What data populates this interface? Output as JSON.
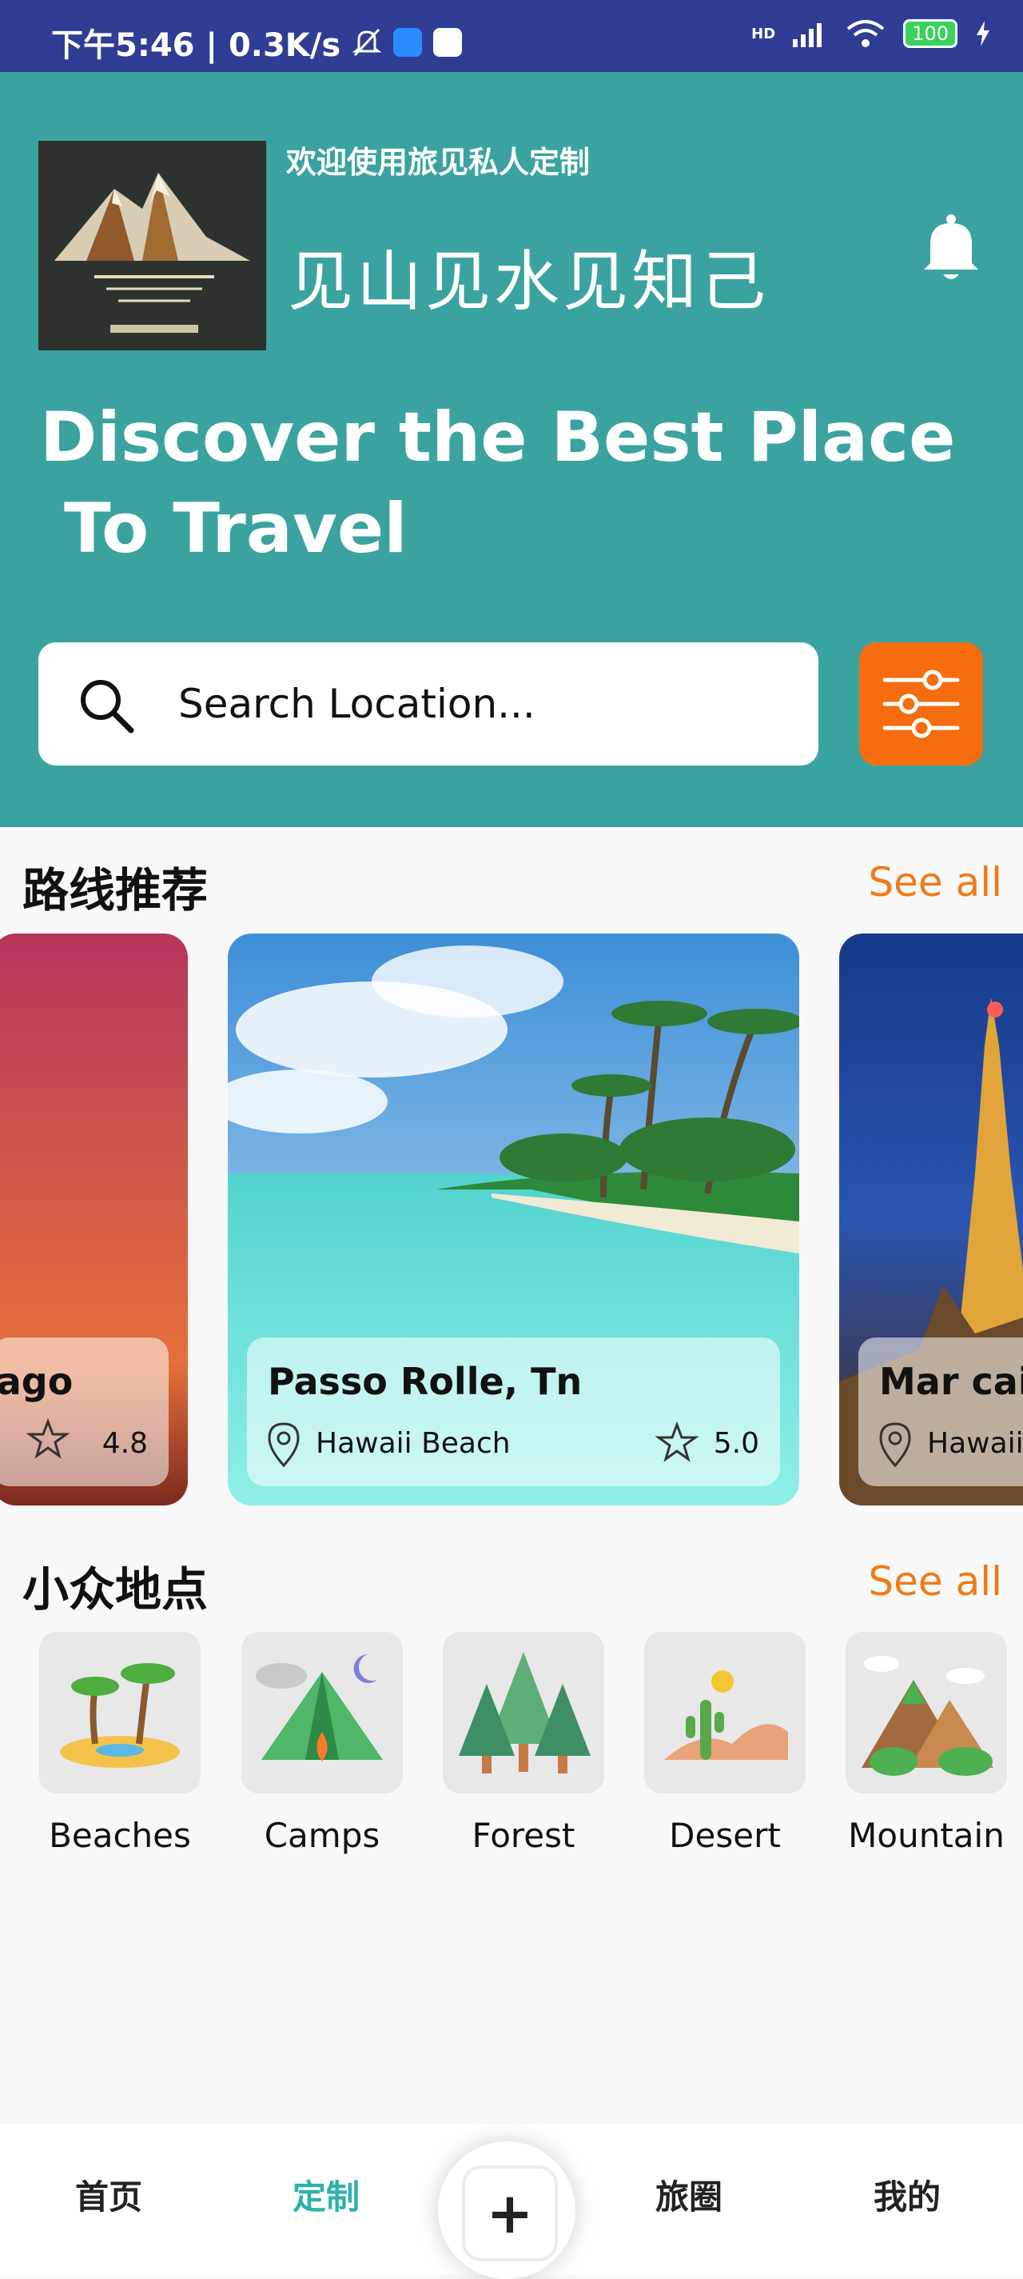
{
  "status_bar": {
    "time_speed": "下午5:46 | 0.3K/s",
    "network": "HD",
    "battery": "100"
  },
  "header": {
    "welcome": "欢迎使用旅见私人定制",
    "brand": "见山见水见知己",
    "headline_line1": "Discover the Best Place",
    "headline_line2": " To Travel",
    "search_placeholder": "Search Location...",
    "bell_icon": "bell-icon",
    "filter_icon": "sliders-icon"
  },
  "colors": {
    "teal": "#3aa39f",
    "orange": "#f56d0e",
    "status_bar": "#2f3d94",
    "active_nav": "#2ab3a9"
  },
  "routes": {
    "title": "路线推荐",
    "see_all": "See all",
    "cards": [
      {
        "title": "lago",
        "rating": "4.8"
      },
      {
        "title": "Passo Rolle, Tn",
        "location": "Hawaii Beach",
        "rating": "5.0"
      },
      {
        "title": "Mar caib",
        "location": "Hawaii"
      }
    ]
  },
  "niche": {
    "title": "小众地点",
    "see_all": "See all",
    "categories": [
      {
        "label": "Beaches",
        "icon": "beach-icon"
      },
      {
        "label": "Camps",
        "icon": "tent-icon"
      },
      {
        "label": "Forest",
        "icon": "forest-icon"
      },
      {
        "label": "Desert",
        "icon": "desert-icon"
      },
      {
        "label": "Mountain",
        "icon": "mountain-icon"
      }
    ]
  },
  "bottom_nav": {
    "home": "首页",
    "custom": "定制",
    "add": "+",
    "circle": "旅圈",
    "mine": "我的"
  }
}
